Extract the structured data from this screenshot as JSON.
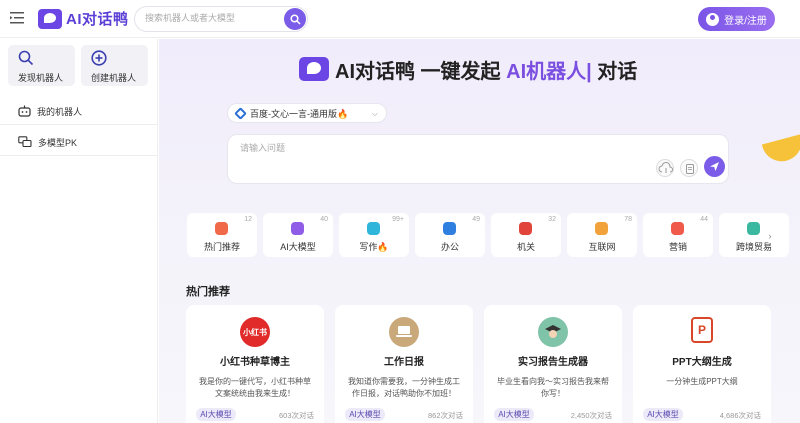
{
  "header": {
    "logo_text": "AI对话鸭",
    "search_placeholder": "搜索机器人或者大模型",
    "login_label": "登录/注册"
  },
  "sidebar": {
    "discover_label": "发现机器人",
    "create_label": "创建机器人",
    "items": [
      {
        "label": "我的机器人"
      },
      {
        "label": "多模型PK"
      }
    ]
  },
  "hero": {
    "title_prefix": "AI对话鸭 一键发起 ",
    "title_ai": "AI机器人|",
    "title_suffix": " 对话"
  },
  "model_select": {
    "value": "百度-文心一言-通用版🔥"
  },
  "ask": {
    "placeholder": "请输入问题"
  },
  "categories": [
    {
      "label": "热门推荐",
      "count": "12",
      "color": "#f06a4a"
    },
    {
      "label": "AI大模型",
      "count": "40",
      "color": "#8f5ce8"
    },
    {
      "label": "写作🔥",
      "count": "99+",
      "color": "#2fb5d9"
    },
    {
      "label": "办公",
      "count": "49",
      "color": "#2f7fe0"
    },
    {
      "label": "机关",
      "count": "32",
      "color": "#e0443a"
    },
    {
      "label": "互联网",
      "count": "78",
      "color": "#f2a23a"
    },
    {
      "label": "营销",
      "count": "44",
      "color": "#ef5a4a"
    },
    {
      "label": "跨境贸易",
      "count": "",
      "color": "#3ab8a0"
    }
  ],
  "section": {
    "title": "热门推荐"
  },
  "cards": [
    {
      "title": "小红书种草博主",
      "avatar": "小红书",
      "desc": "我是你的一键代写，小红书种草文案统统由我来生成！",
      "tag": "AI大模型",
      "uses": "603次对话",
      "avatar_color": "#e12b2b"
    },
    {
      "title": "工作日报",
      "avatar": "",
      "desc": "我知道你需要我，一分钟生成工作日报，对话鸭助你不加班！",
      "tag": "AI大模型",
      "uses": "862次对话",
      "avatar_color": "#c9a97a"
    },
    {
      "title": "实习报告生成器",
      "avatar": "",
      "desc": "毕业生看向我～实习报告我来帮你写！",
      "tag": "AI大模型",
      "uses": "2,450次对话",
      "avatar_color": "#7fc3a8"
    },
    {
      "title": "PPT大纲生成",
      "avatar": "P",
      "desc": "一分钟生成PPT大纲",
      "tag": "AI大模型",
      "uses": "4,686次对话",
      "avatar_color": "#d9472b"
    }
  ]
}
